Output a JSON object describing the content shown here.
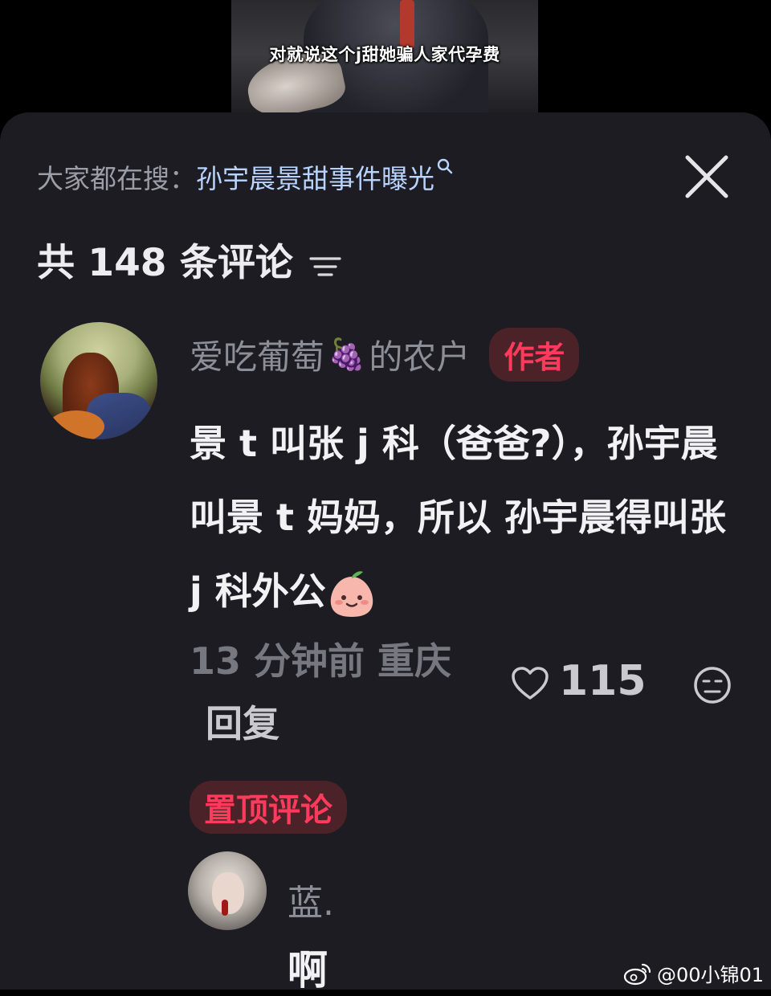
{
  "video": {
    "subtitle": "对就说这个j甜她骗人家代孕费"
  },
  "search": {
    "prefix": "大家都在搜：",
    "term": "孙宇晨景甜事件曝光"
  },
  "comments_header": {
    "count_text": "共 148 条评论"
  },
  "comment": {
    "username_part1": "爱吃葡萄",
    "username_part2": "的农户",
    "badge": "作者",
    "text": "景 t 叫张 j 科（爸爸?），孙宇晨叫景 t 妈妈，所以 孙宇晨得叫张 j 科外公",
    "time_location": "13 分钟前 重庆",
    "reply_label": "回复",
    "likes": "115"
  },
  "pinned": {
    "badge": "置顶评论",
    "username": "蓝.",
    "text": "啊"
  },
  "watermark": {
    "text": "@00小锦01"
  },
  "icons": [
    "search-icon",
    "close-icon",
    "sort-icon",
    "grape-icon",
    "peach-icon",
    "heart-icon",
    "dislike-icon",
    "weibo-icon"
  ],
  "colors": {
    "panel": "#1c1c22",
    "badge_bg": "#4b2227",
    "badge_text": "#ff3a5c",
    "search_term": "#b9d3ff"
  }
}
